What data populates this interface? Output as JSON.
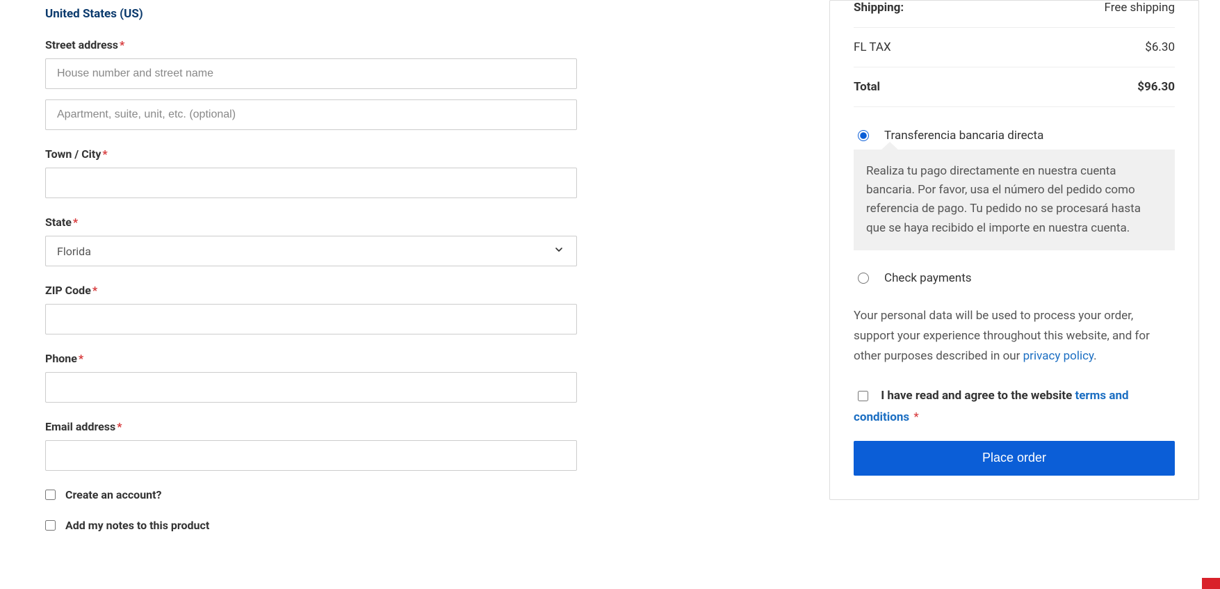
{
  "billing": {
    "country_display": "United States (US)",
    "street_label": "Street address",
    "street_placeholder": "House number and street name",
    "street2_placeholder": "Apartment, suite, unit, etc. (optional)",
    "city_label": "Town / City",
    "state_label": "State",
    "state_value": "Florida",
    "zip_label": "ZIP Code",
    "phone_label": "Phone",
    "email_label": "Email address",
    "create_account_label": "Create an account?",
    "order_notes_label": "Add my notes to this product"
  },
  "order": {
    "shipping_label": "Shipping:",
    "shipping_value": "Free shipping",
    "tax_label": "FL TAX",
    "tax_value": "$6.30",
    "total_label": "Total",
    "total_value": "$96.30"
  },
  "payment": {
    "bacs_label": "Transferencia bancaria directa",
    "bacs_desc": "Realiza tu pago directamente en nuestra cuenta bancaria. Por favor, usa el número del pedido como referencia de pago. Tu pedido no se procesará hasta que se haya recibido el importe en nuestra cuenta.",
    "cheque_label": "Check payments"
  },
  "privacy": {
    "text_before": "Your personal data will be used to process your order, support your experience throughout this website, and for other purposes described in our ",
    "link": "privacy policy",
    "text_after": "."
  },
  "terms": {
    "text_before": "I have read and agree to the website ",
    "link": "terms and conditions"
  },
  "buttons": {
    "place_order": "Place order"
  }
}
